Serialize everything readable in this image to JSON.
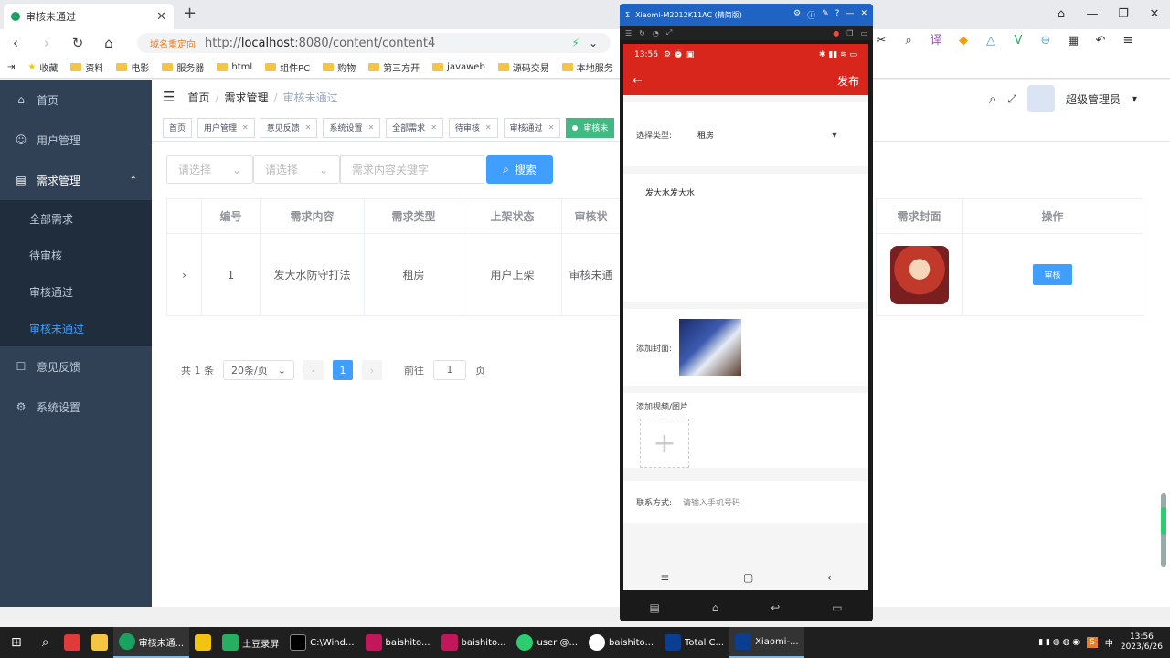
{
  "browser": {
    "tab_title": "审核未通过",
    "redirect_label": "域名重定向",
    "url_prefix": "http://",
    "url_host": "localhost",
    "url_rest": ":8080/content/content4",
    "bookmarks": [
      "收藏",
      "资料",
      "电影",
      "服务器",
      "html",
      "组件PC",
      "购物",
      "第三方开",
      "javaweb",
      "源码交易",
      "本地服务"
    ]
  },
  "sidebar": {
    "items": [
      {
        "label": "首页"
      },
      {
        "label": "用户管理"
      },
      {
        "label": "需求管理"
      },
      {
        "label": "意见反馈"
      },
      {
        "label": "系统设置"
      }
    ],
    "sub": [
      {
        "label": "全部需求"
      },
      {
        "label": "待审核"
      },
      {
        "label": "审核通过"
      },
      {
        "label": "审核未通过"
      }
    ]
  },
  "header": {
    "breadcrumb": [
      "首页",
      "需求管理",
      "审核未通过"
    ],
    "username": "超级管理员"
  },
  "tags": [
    "首页",
    "用户管理",
    "意见反馈",
    "系统设置",
    "全部需求",
    "待审核",
    "审核通过",
    "审核未"
  ],
  "filters": {
    "select1": "请选择",
    "select2": "请选择",
    "keyword": "需求内容关键字",
    "search": "搜索"
  },
  "table": {
    "headers": [
      "编号",
      "需求内容",
      "需求类型",
      "上架状态",
      "审核状"
    ],
    "headers_right": [
      "需求封面",
      "操作"
    ],
    "row": [
      "1",
      "发大水防守打法",
      "租房",
      "用户上架",
      "审核未通"
    ],
    "action": "审核"
  },
  "pager": {
    "total": "共 1 条",
    "size": "20条/页",
    "current": "1",
    "goto": "前往",
    "goto_val": "1",
    "page_unit": "页"
  },
  "phone": {
    "window_title": "Xiaomi-M2012K11AC (精简版)",
    "time": "13:56",
    "publish": "发布",
    "type_label": "选择类型:",
    "type_value": "租房",
    "content": "发大水发大水",
    "cover_label": "添加封面:",
    "media_label": "添加视频/图片",
    "contact_label": "联系方式:",
    "contact_placeholder": "请输入手机号码"
  },
  "taskbar": {
    "items": [
      "审核未通...",
      "土豆录屏",
      "C:\\Wind...",
      "baishito...",
      "baishito...",
      "user @...",
      "baishito...",
      "Total C...",
      "Xiaomi-..."
    ],
    "time": "13:56",
    "date": "2023/6/26"
  }
}
